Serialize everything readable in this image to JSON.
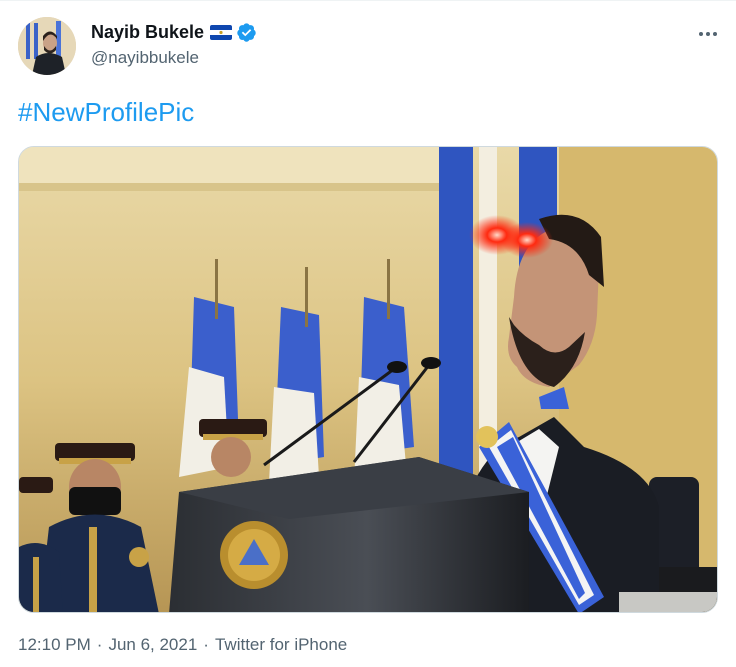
{
  "author": {
    "display_name": "Nayib Bukele",
    "handle": "@nayibbukele",
    "flag_icon": "el-salvador-flag-icon",
    "verified_icon": "verified-badge-icon"
  },
  "tweet": {
    "text": "#NewProfilePic"
  },
  "meta": {
    "time": "12:10 PM",
    "date": "Jun 6, 2021",
    "source": "Twitter for iPhone",
    "separator": "·"
  },
  "colors": {
    "link": "#1d9bf0",
    "secondary_text": "#536471",
    "verified": "#1d9bf0"
  }
}
